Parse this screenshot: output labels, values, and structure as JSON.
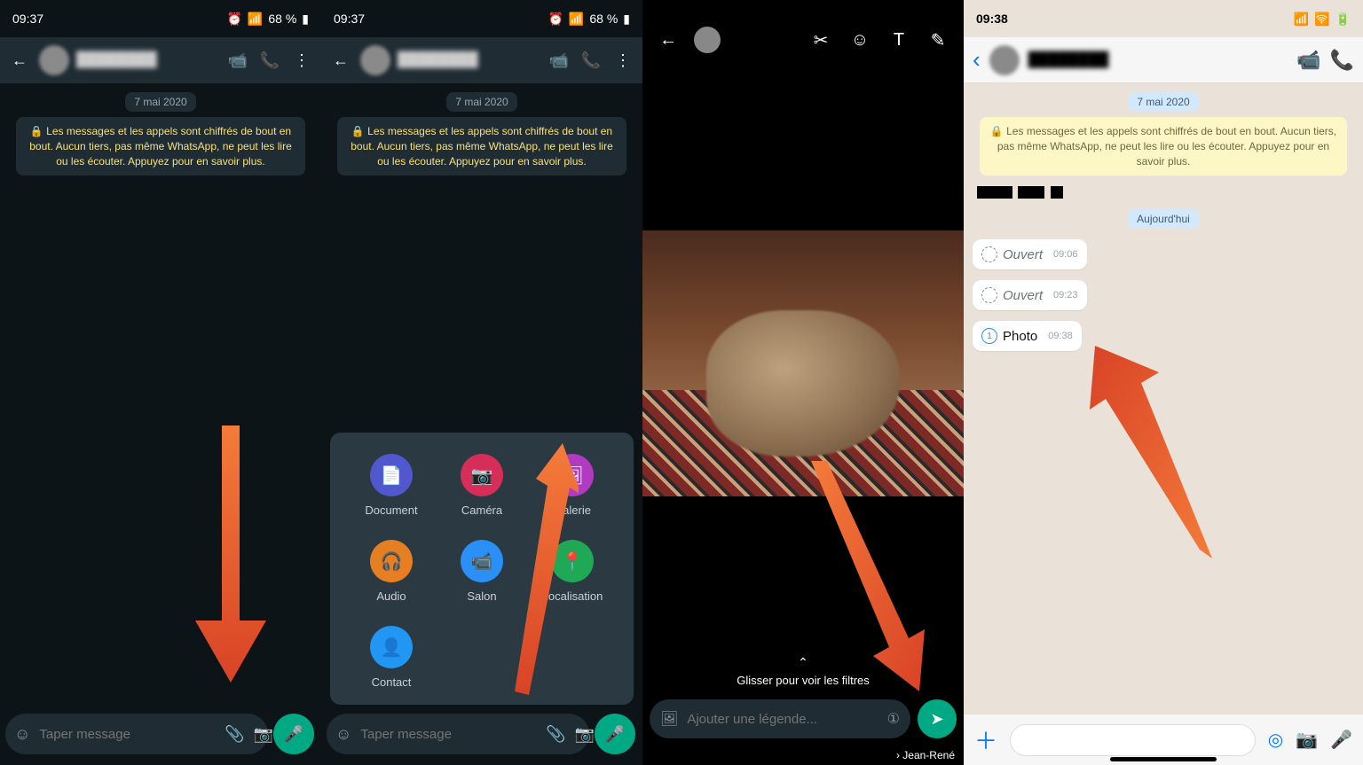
{
  "android": {
    "time": "09:37",
    "battery": "68 %",
    "contact_name": "████████",
    "date_chip": "7 mai 2020",
    "encryption": "🔒 Les messages et les appels sont chiffrés de bout en bout. Aucun tiers, pas même WhatsApp, ne peut les lire ou les écouter. Appuyez pour en savoir plus.",
    "placeholder": "Taper message"
  },
  "attach": {
    "document": "Document",
    "camera": "Caméra",
    "gallery": "Galerie",
    "audio": "Audio",
    "room": "Salon",
    "location": "Localisation",
    "contact": "Contact"
  },
  "editor": {
    "filters_hint": "Glisser pour voir les filtres",
    "caption_placeholder": "Ajouter une légende...",
    "recipient": "Jean-René"
  },
  "ios": {
    "time": "09:38",
    "contact_name": "████████",
    "date_chip": "7 mai 2020",
    "encryption": "🔒 Les messages et les appels sont chiffrés de bout en bout. Aucun tiers, pas même WhatsApp, ne peut les lire ou les écouter. Appuyez pour en savoir plus.",
    "today": "Aujourd'hui",
    "msgs": [
      {
        "label": "Ouvert",
        "time": "09:06"
      },
      {
        "label": "Ouvert",
        "time": "09:23"
      },
      {
        "label": "Photo",
        "time": "09:38"
      }
    ]
  },
  "colors": {
    "doc": "#5157cd",
    "cam": "#d62e58",
    "gal": "#b03bc2",
    "aud": "#e67e22",
    "room": "#2a8ff7",
    "loc": "#1fa855",
    "con": "#2196f3",
    "accent": "#00a884"
  }
}
